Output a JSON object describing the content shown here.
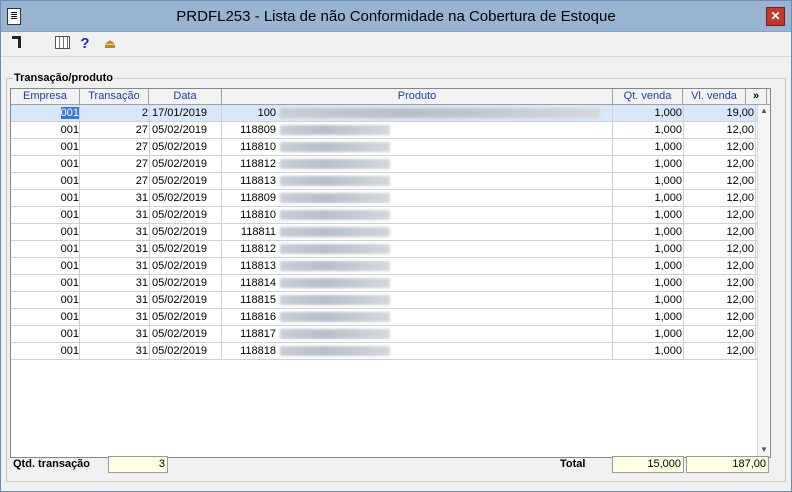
{
  "window": {
    "title": "PRDFL253 - Lista de não Conformidade na Cobertura de Estoque",
    "close_label": "✕",
    "icon_label": "≣"
  },
  "toolbar": {
    "help_label": "?",
    "exit_label": "⏏"
  },
  "group_label": "Transação/produto",
  "grid": {
    "columns": [
      "Empresa",
      "Transação",
      "Data",
      "Produto",
      "Qt. venda",
      "Vl. venda",
      "»"
    ],
    "rows": [
      {
        "empresa": "001",
        "transacao": "2",
        "data": "17/01/2019",
        "codigo": "100",
        "qt": "1,000",
        "vl": "19,00"
      },
      {
        "empresa": "001",
        "transacao": "27",
        "data": "05/02/2019",
        "codigo": "118809",
        "qt": "1,000",
        "vl": "12,00"
      },
      {
        "empresa": "001",
        "transacao": "27",
        "data": "05/02/2019",
        "codigo": "118810",
        "qt": "1,000",
        "vl": "12,00"
      },
      {
        "empresa": "001",
        "transacao": "27",
        "data": "05/02/2019",
        "codigo": "118812",
        "qt": "1,000",
        "vl": "12,00"
      },
      {
        "empresa": "001",
        "transacao": "27",
        "data": "05/02/2019",
        "codigo": "118813",
        "qt": "1,000",
        "vl": "12,00"
      },
      {
        "empresa": "001",
        "transacao": "31",
        "data": "05/02/2019",
        "codigo": "118809",
        "qt": "1,000",
        "vl": "12,00"
      },
      {
        "empresa": "001",
        "transacao": "31",
        "data": "05/02/2019",
        "codigo": "118810",
        "qt": "1,000",
        "vl": "12,00"
      },
      {
        "empresa": "001",
        "transacao": "31",
        "data": "05/02/2019",
        "codigo": "118811",
        "qt": "1,000",
        "vl": "12,00"
      },
      {
        "empresa": "001",
        "transacao": "31",
        "data": "05/02/2019",
        "codigo": "118812",
        "qt": "1,000",
        "vl": "12,00"
      },
      {
        "empresa": "001",
        "transacao": "31",
        "data": "05/02/2019",
        "codigo": "118813",
        "qt": "1,000",
        "vl": "12,00"
      },
      {
        "empresa": "001",
        "transacao": "31",
        "data": "05/02/2019",
        "codigo": "118814",
        "qt": "1,000",
        "vl": "12,00"
      },
      {
        "empresa": "001",
        "transacao": "31",
        "data": "05/02/2019",
        "codigo": "118815",
        "qt": "1,000",
        "vl": "12,00"
      },
      {
        "empresa": "001",
        "transacao": "31",
        "data": "05/02/2019",
        "codigo": "118816",
        "qt": "1,000",
        "vl": "12,00"
      },
      {
        "empresa": "001",
        "transacao": "31",
        "data": "05/02/2019",
        "codigo": "118817",
        "qt": "1,000",
        "vl": "12,00"
      },
      {
        "empresa": "001",
        "transacao": "31",
        "data": "05/02/2019",
        "codigo": "118818",
        "qt": "1,000",
        "vl": "12,00"
      }
    ]
  },
  "footer": {
    "qtd_label": "Qtd. transação",
    "qtd_value": "3",
    "total_label": "Total",
    "total_qt": "15,000",
    "total_vl": "187,00"
  },
  "colors": {
    "titlebar": "#99b4d1",
    "header_text": "#1f3fa3",
    "field_bg": "#ffffe1",
    "selection": "#3b78d8"
  }
}
